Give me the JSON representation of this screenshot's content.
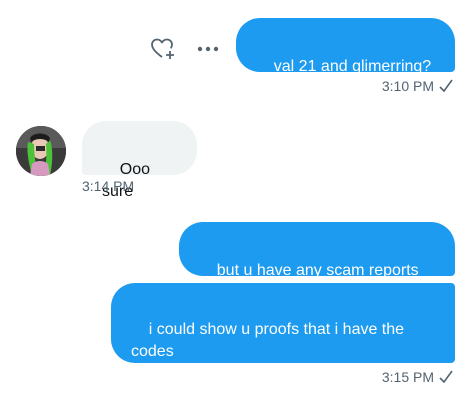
{
  "messages": [
    {
      "text": "val 21 and glimerring?",
      "time": "3:10 PM"
    },
    {
      "text": "Ooo sure",
      "time": "3:14 PM"
    },
    {
      "text": "but u have any scam reports"
    },
    {
      "text": "i could show u proofs that i have the codes",
      "time": "3:15 PM"
    }
  ],
  "icons": {
    "react": "heart-plus-icon",
    "more": "more-icon",
    "sent": "checkmark-icon"
  },
  "colors": {
    "outgoing_bubble": "#1d9bf0",
    "incoming_bubble": "#eff3f4",
    "timestamp": "#536471"
  }
}
